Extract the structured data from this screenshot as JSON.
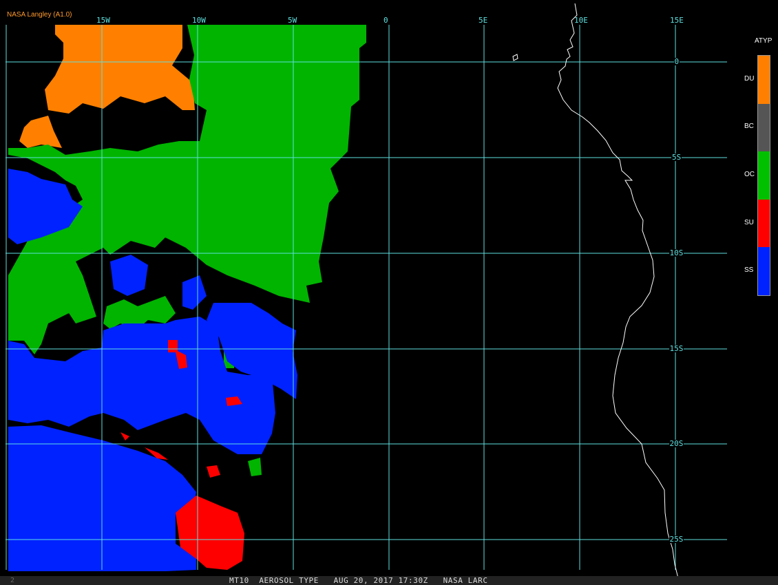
{
  "attribution": "NASA Langley (A1.0)",
  "lon_labels": [
    "15W",
    "10W",
    "5W",
    "0",
    "5E",
    "10E",
    "15E"
  ],
  "lat_labels": [
    "0",
    "5S",
    "10S",
    "15S",
    "20S",
    "25S"
  ],
  "legend": {
    "title": "ATYP",
    "entries": [
      {
        "code": "DU",
        "color": "#ff8000"
      },
      {
        "code": "BC",
        "color": "#555555"
      },
      {
        "code": "OC",
        "color": "#00c000"
      },
      {
        "code": "SU",
        "color": "#ff0000"
      },
      {
        "code": "SS",
        "color": "#0022ff"
      }
    ]
  },
  "status_index": "2",
  "status_text": "MT10  AEROSOL TYPE   AUG 20, 2017 17:30Z   NASA LARC",
  "colors": {
    "grid": "#5fe0e0",
    "coast": "#ffffff",
    "background": "#000000"
  }
}
